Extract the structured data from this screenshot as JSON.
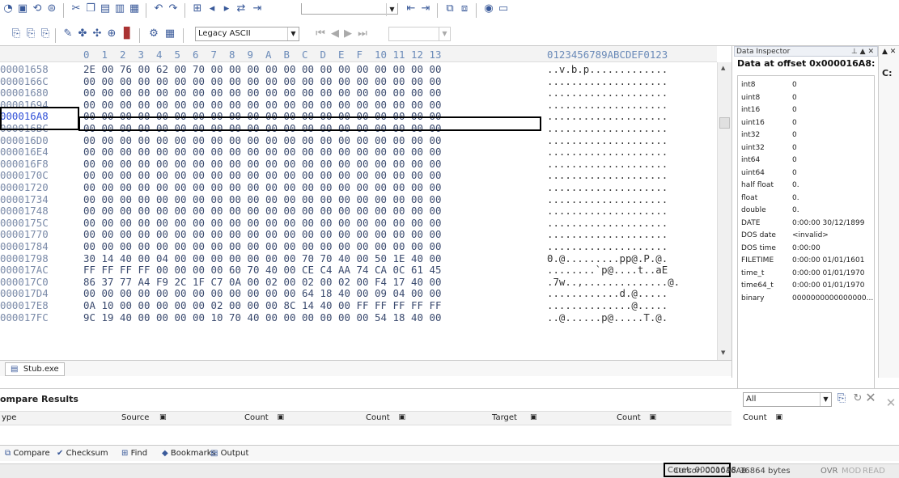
{
  "toolbar": {
    "encoding_label": "Legacy ASCII",
    "encoding_arrow": "▼",
    "nav_combo_value": ""
  },
  "hex_header": {
    "columns": [
      "0",
      "1",
      "2",
      "3",
      "4",
      "5",
      "6",
      "7",
      "8",
      "9",
      "A",
      "B",
      "C",
      "D",
      "E",
      "F",
      "10",
      "11",
      "12",
      "13"
    ],
    "ascii_header": "0123456789ABCDEF0123"
  },
  "rows": [
    {
      "addr": "00001658",
      "bytes": [
        "2E",
        "00",
        "76",
        "00",
        "62",
        "00",
        "70",
        "00",
        "00",
        "00",
        "00",
        "00",
        "00",
        "00",
        "00",
        "00",
        "00",
        "00",
        "00",
        "00"
      ],
      "ascii": "..v.b.p............."
    },
    {
      "addr": "0000166C",
      "bytes": [
        "00",
        "00",
        "00",
        "00",
        "00",
        "00",
        "00",
        "00",
        "00",
        "00",
        "00",
        "00",
        "00",
        "00",
        "00",
        "00",
        "00",
        "00",
        "00",
        "00"
      ],
      "ascii": "...................."
    },
    {
      "addr": "00001680",
      "bytes": [
        "00",
        "00",
        "00",
        "00",
        "00",
        "00",
        "00",
        "00",
        "00",
        "00",
        "00",
        "00",
        "00",
        "00",
        "00",
        "00",
        "00",
        "00",
        "00",
        "00"
      ],
      "ascii": "...................."
    },
    {
      "addr": "00001694",
      "bytes": [
        "00",
        "00",
        "00",
        "00",
        "00",
        "00",
        "00",
        "00",
        "00",
        "00",
        "00",
        "00",
        "00",
        "00",
        "00",
        "00",
        "00",
        "00",
        "00",
        "00"
      ],
      "ascii": "...................."
    },
    {
      "addr": "000016A8",
      "bytes": [
        "00",
        "00",
        "00",
        "00",
        "00",
        "00",
        "00",
        "00",
        "00",
        "00",
        "00",
        "00",
        "00",
        "00",
        "00",
        "00",
        "00",
        "00",
        "00",
        "00"
      ],
      "ascii": "...................."
    },
    {
      "addr": "000016BC",
      "bytes": [
        "00",
        "00",
        "00",
        "00",
        "00",
        "00",
        "00",
        "00",
        "00",
        "00",
        "00",
        "00",
        "00",
        "00",
        "00",
        "00",
        "00",
        "00",
        "00",
        "00"
      ],
      "ascii": "...................."
    },
    {
      "addr": "000016D0",
      "bytes": [
        "00",
        "00",
        "00",
        "00",
        "00",
        "00",
        "00",
        "00",
        "00",
        "00",
        "00",
        "00",
        "00",
        "00",
        "00",
        "00",
        "00",
        "00",
        "00",
        "00"
      ],
      "ascii": "...................."
    },
    {
      "addr": "000016E4",
      "bytes": [
        "00",
        "00",
        "00",
        "00",
        "00",
        "00",
        "00",
        "00",
        "00",
        "00",
        "00",
        "00",
        "00",
        "00",
        "00",
        "00",
        "00",
        "00",
        "00",
        "00"
      ],
      "ascii": "...................."
    },
    {
      "addr": "000016F8",
      "bytes": [
        "00",
        "00",
        "00",
        "00",
        "00",
        "00",
        "00",
        "00",
        "00",
        "00",
        "00",
        "00",
        "00",
        "00",
        "00",
        "00",
        "00",
        "00",
        "00",
        "00"
      ],
      "ascii": "...................."
    },
    {
      "addr": "0000170C",
      "bytes": [
        "00",
        "00",
        "00",
        "00",
        "00",
        "00",
        "00",
        "00",
        "00",
        "00",
        "00",
        "00",
        "00",
        "00",
        "00",
        "00",
        "00",
        "00",
        "00",
        "00"
      ],
      "ascii": "...................."
    },
    {
      "addr": "00001720",
      "bytes": [
        "00",
        "00",
        "00",
        "00",
        "00",
        "00",
        "00",
        "00",
        "00",
        "00",
        "00",
        "00",
        "00",
        "00",
        "00",
        "00",
        "00",
        "00",
        "00",
        "00"
      ],
      "ascii": "...................."
    },
    {
      "addr": "00001734",
      "bytes": [
        "00",
        "00",
        "00",
        "00",
        "00",
        "00",
        "00",
        "00",
        "00",
        "00",
        "00",
        "00",
        "00",
        "00",
        "00",
        "00",
        "00",
        "00",
        "00",
        "00"
      ],
      "ascii": "...................."
    },
    {
      "addr": "00001748",
      "bytes": [
        "00",
        "00",
        "00",
        "00",
        "00",
        "00",
        "00",
        "00",
        "00",
        "00",
        "00",
        "00",
        "00",
        "00",
        "00",
        "00",
        "00",
        "00",
        "00",
        "00"
      ],
      "ascii": "...................."
    },
    {
      "addr": "0000175C",
      "bytes": [
        "00",
        "00",
        "00",
        "00",
        "00",
        "00",
        "00",
        "00",
        "00",
        "00",
        "00",
        "00",
        "00",
        "00",
        "00",
        "00",
        "00",
        "00",
        "00",
        "00"
      ],
      "ascii": "...................."
    },
    {
      "addr": "00001770",
      "bytes": [
        "00",
        "00",
        "00",
        "00",
        "00",
        "00",
        "00",
        "00",
        "00",
        "00",
        "00",
        "00",
        "00",
        "00",
        "00",
        "00",
        "00",
        "00",
        "00",
        "00"
      ],
      "ascii": "...................."
    },
    {
      "addr": "00001784",
      "bytes": [
        "00",
        "00",
        "00",
        "00",
        "00",
        "00",
        "00",
        "00",
        "00",
        "00",
        "00",
        "00",
        "00",
        "00",
        "00",
        "00",
        "00",
        "00",
        "00",
        "00"
      ],
      "ascii": "...................."
    },
    {
      "addr": "00001798",
      "bytes": [
        "30",
        "14",
        "40",
        "00",
        "04",
        "00",
        "00",
        "00",
        "00",
        "00",
        "00",
        "00",
        "70",
        "70",
        "40",
        "00",
        "50",
        "1E",
        "40",
        "00"
      ],
      "ascii": "0.@.........pp@.P.@."
    },
    {
      "addr": "000017AC",
      "bytes": [
        "FF",
        "FF",
        "FF",
        "FF",
        "00",
        "00",
        "00",
        "00",
        "60",
        "70",
        "40",
        "00",
        "CE",
        "C4",
        "AA",
        "74",
        "CA",
        "0C",
        "61",
        "45"
      ],
      "ascii": "........`p@....t..aE"
    },
    {
      "addr": "000017C0",
      "bytes": [
        "86",
        "37",
        "77",
        "A4",
        "F9",
        "2C",
        "1F",
        "C7",
        "0A",
        "00",
        "02",
        "00",
        "02",
        "00",
        "02",
        "00",
        "F4",
        "17",
        "40",
        "00"
      ],
      "ascii": ".7w..,..............@."
    },
    {
      "addr": "000017D4",
      "bytes": [
        "00",
        "00",
        "00",
        "00",
        "00",
        "00",
        "00",
        "00",
        "00",
        "00",
        "00",
        "00",
        "64",
        "18",
        "40",
        "00",
        "09",
        "04",
        "00",
        "00"
      ],
      "ascii": "............d.@....."
    },
    {
      "addr": "000017E8",
      "bytes": [
        "0A",
        "10",
        "00",
        "00",
        "00",
        "00",
        "00",
        "02",
        "00",
        "00",
        "00",
        "8C",
        "14",
        "40",
        "00",
        "FF",
        "FF",
        "FF",
        "FF",
        "FF"
      ],
      "ascii": "..............@....."
    },
    {
      "addr": "000017FC",
      "bytes": [
        "9C",
        "19",
        "40",
        "00",
        "00",
        "00",
        "00",
        "10",
        "70",
        "40",
        "00",
        "00",
        "00",
        "00",
        "00",
        "00",
        "54",
        "18",
        "40",
        "00"
      ],
      "ascii": "..@......p@.....T.@."
    }
  ],
  "file_tab": "Stub.exe",
  "inspector": {
    "header": "Data Inspector",
    "header_controls": "⊥ ▲ ✕",
    "title": "Data at offset 0x000016A8:",
    "fields": [
      {
        "name": "int8",
        "value": "0"
      },
      {
        "name": "uint8",
        "value": "0"
      },
      {
        "name": "int16",
        "value": "0"
      },
      {
        "name": "uint16",
        "value": "0"
      },
      {
        "name": "int32",
        "value": "0"
      },
      {
        "name": "uint32",
        "value": "0"
      },
      {
        "name": "int64",
        "value": "0"
      },
      {
        "name": "uint64",
        "value": "0"
      },
      {
        "name": "half float",
        "value": "0."
      },
      {
        "name": "float",
        "value": "0."
      },
      {
        "name": "double",
        "value": "0."
      },
      {
        "name": "DATE",
        "value": "0:00:00 30/12/1899"
      },
      {
        "name": "DOS date",
        "value": "<invalid>"
      },
      {
        "name": "DOS time",
        "value": "0:00:00"
      },
      {
        "name": "FILETIME",
        "value": "0:00:00 01/01/1601"
      },
      {
        "name": "time_t",
        "value": "0:00:00 01/01/1970"
      },
      {
        "name": "time64_t",
        "value": "0:00:00 01/01/1970"
      },
      {
        "name": "binary",
        "value": "0000000000000000..."
      }
    ],
    "side_label": "C:"
  },
  "compare": {
    "title": "ompare Results",
    "filter_value": "All",
    "columns": [
      "ype",
      "Source",
      "Count",
      "Count",
      "Target",
      "Count",
      "Count"
    ]
  },
  "bottom_tabs": [
    "Compare",
    "Checksum",
    "Find",
    "Bookmarks",
    "Output"
  ],
  "status": {
    "cursor": "Cursor: 000016A8",
    "caret": "Caret: 000016A8",
    "size": "36864 bytes",
    "ovr": "OVR",
    "mod": "MOD",
    "read": "READ"
  }
}
